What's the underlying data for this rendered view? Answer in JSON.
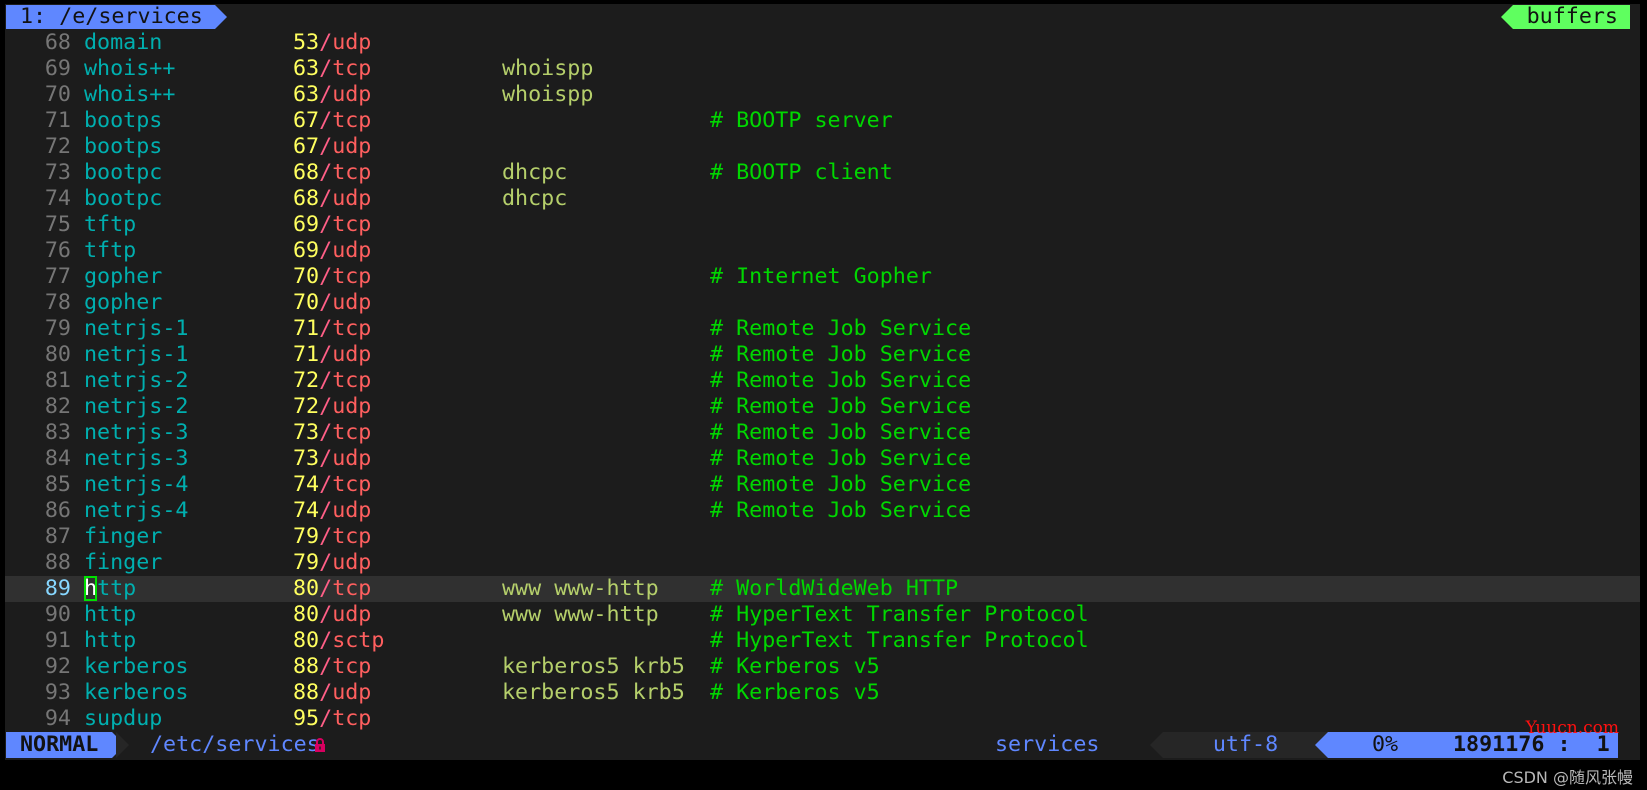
{
  "tabline": {
    "active_tab": "1: /e/services",
    "right_label": "buffers"
  },
  "cursor": {
    "line": 89,
    "char": "h"
  },
  "lines": [
    {
      "num": "68",
      "name": "domain",
      "port": "53",
      "proto": "udp",
      "aliases": "",
      "comment": ""
    },
    {
      "num": "69",
      "name": "whois++",
      "port": "63",
      "proto": "tcp",
      "aliases": "whoispp",
      "comment": ""
    },
    {
      "num": "70",
      "name": "whois++",
      "port": "63",
      "proto": "udp",
      "aliases": "whoispp",
      "comment": ""
    },
    {
      "num": "71",
      "name": "bootps",
      "port": "67",
      "proto": "tcp",
      "aliases": "",
      "comment": "# BOOTP server"
    },
    {
      "num": "72",
      "name": "bootps",
      "port": "67",
      "proto": "udp",
      "aliases": "",
      "comment": ""
    },
    {
      "num": "73",
      "name": "bootpc",
      "port": "68",
      "proto": "tcp",
      "aliases": "dhcpc",
      "comment": "# BOOTP client"
    },
    {
      "num": "74",
      "name": "bootpc",
      "port": "68",
      "proto": "udp",
      "aliases": "dhcpc",
      "comment": ""
    },
    {
      "num": "75",
      "name": "tftp",
      "port": "69",
      "proto": "tcp",
      "aliases": "",
      "comment": ""
    },
    {
      "num": "76",
      "name": "tftp",
      "port": "69",
      "proto": "udp",
      "aliases": "",
      "comment": ""
    },
    {
      "num": "77",
      "name": "gopher",
      "port": "70",
      "proto": "tcp",
      "aliases": "",
      "comment": "# Internet Gopher"
    },
    {
      "num": "78",
      "name": "gopher",
      "port": "70",
      "proto": "udp",
      "aliases": "",
      "comment": ""
    },
    {
      "num": "79",
      "name": "netrjs-1",
      "port": "71",
      "proto": "tcp",
      "aliases": "",
      "comment": "# Remote Job Service"
    },
    {
      "num": "80",
      "name": "netrjs-1",
      "port": "71",
      "proto": "udp",
      "aliases": "",
      "comment": "# Remote Job Service"
    },
    {
      "num": "81",
      "name": "netrjs-2",
      "port": "72",
      "proto": "tcp",
      "aliases": "",
      "comment": "# Remote Job Service"
    },
    {
      "num": "82",
      "name": "netrjs-2",
      "port": "72",
      "proto": "udp",
      "aliases": "",
      "comment": "# Remote Job Service"
    },
    {
      "num": "83",
      "name": "netrjs-3",
      "port": "73",
      "proto": "tcp",
      "aliases": "",
      "comment": "# Remote Job Service"
    },
    {
      "num": "84",
      "name": "netrjs-3",
      "port": "73",
      "proto": "udp",
      "aliases": "",
      "comment": "# Remote Job Service"
    },
    {
      "num": "85",
      "name": "netrjs-4",
      "port": "74",
      "proto": "tcp",
      "aliases": "",
      "comment": "# Remote Job Service"
    },
    {
      "num": "86",
      "name": "netrjs-4",
      "port": "74",
      "proto": "udp",
      "aliases": "",
      "comment": "# Remote Job Service"
    },
    {
      "num": "87",
      "name": "finger",
      "port": "79",
      "proto": "tcp",
      "aliases": "",
      "comment": ""
    },
    {
      "num": "88",
      "name": "finger",
      "port": "79",
      "proto": "udp",
      "aliases": "",
      "comment": ""
    },
    {
      "num": "89",
      "name": "http",
      "port": "80",
      "proto": "tcp",
      "aliases": "www www-http",
      "comment": "# WorldWideWeb HTTP"
    },
    {
      "num": "90",
      "name": "http",
      "port": "80",
      "proto": "udp",
      "aliases": "www www-http",
      "comment": "# HyperText Transfer Protocol"
    },
    {
      "num": "91",
      "name": "http",
      "port": "80",
      "proto": "sctp",
      "aliases": "",
      "comment": "# HyperText Transfer Protocol"
    },
    {
      "num": "92",
      "name": "kerberos",
      "port": "88",
      "proto": "tcp",
      "aliases": "kerberos5 krb5",
      "comment": "# Kerberos v5"
    },
    {
      "num": "93",
      "name": "kerberos",
      "port": "88",
      "proto": "udp",
      "aliases": "kerberos5 krb5",
      "comment": "# Kerberos v5"
    },
    {
      "num": "94",
      "name": "supdup",
      "port": "95",
      "proto": "tcp",
      "aliases": "",
      "comment": ""
    }
  ],
  "statusline": {
    "mode": "NORMAL",
    "filepath": "/etc/services",
    "readonly_icon": "lock-icon",
    "filetype": "services",
    "encoding": "utf-8",
    "percent": "0%",
    "position": "1891176 :  1"
  },
  "watermarks": {
    "top": "Yuucn.com",
    "bottom": "CSDN @随风张幔"
  },
  "colors": {
    "accent": "#5f87ff",
    "buffers": "#5fff5f",
    "background": "#1c1c1c",
    "cursorline": "#303030",
    "name": "#00afaf",
    "port": "#ffff5f",
    "proto": "#ff5f5f",
    "alias": "#b5cf6b",
    "comment": "#00d700",
    "lock": "#d7005f"
  }
}
